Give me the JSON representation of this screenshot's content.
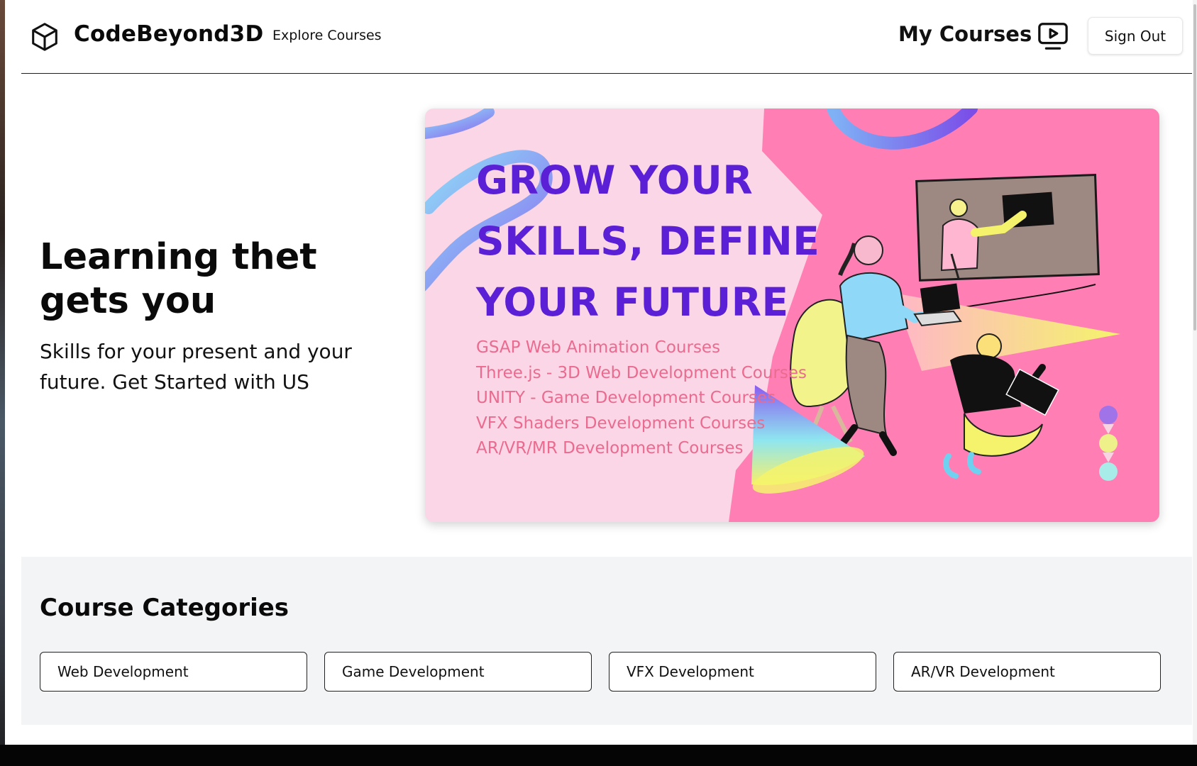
{
  "navbar": {
    "brand": "CodeBeyond3D",
    "explore_label": "Explore Courses",
    "my_courses_label": "My Courses",
    "sign_out_label": "Sign Out"
  },
  "hero": {
    "title": "Learning thet gets you",
    "subtitle": "Skills for your present and your future. Get Started with US"
  },
  "banner": {
    "headline": "GROW YOUR SKILLS, DEFINE YOUR FUTURE",
    "courses": [
      "GSAP  Web Animation Courses",
      "Three.js - 3D Web Development Courses",
      "UNITY - Game Development Courses",
      "VFX Shaders Development Courses",
      "AR/VR/MR Development Courses"
    ]
  },
  "categories": {
    "title": "Course Categories",
    "items": [
      "Web Development",
      "Game Development",
      "VFX Development",
      "AR/VR Development"
    ]
  },
  "colors": {
    "headline_purple": "#5b1fd6",
    "course_pink": "#ea6b8f",
    "banner_pink": "#ff7fb5",
    "banner_light": "#fbd6e6",
    "category_bg": "#f3f4f6"
  },
  "icons": {
    "logo": "cube-icon",
    "my_courses": "tv-play-icon"
  }
}
